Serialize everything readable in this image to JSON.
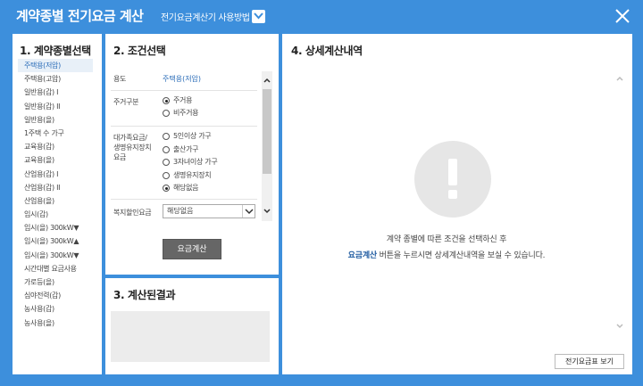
{
  "window": {
    "title": "계약종별 전기요금 계산",
    "help_link": "전기요금계산기 사용방법"
  },
  "panel1": {
    "title": "1. 계약종별선택",
    "items": [
      "주택용(저압)",
      "주택용(고압)",
      "일반용(갑) I",
      "일반용(갑) II",
      "일반용(을)",
      "1주택 수 가구",
      "교육용(갑)",
      "교육용(을)",
      "산업용(갑) I",
      "산업용(갑) II",
      "산업용(을)",
      "임시(갑)",
      "임시(을) 300kW▼",
      "임시(을) 300kW▲",
      "임시(을) 300kW▼",
      "시간대별 요금사용",
      "가로등(을)",
      "심야전력(갑)",
      "농사용(갑)",
      "농사용(을)"
    ],
    "selected_index": 0
  },
  "panel2": {
    "title": "2. 조건선택",
    "usage_label": "용도",
    "usage_value": "주택용(저압)",
    "residence_label": "주거구분",
    "residence_options": [
      "주거용",
      "비주거용"
    ],
    "residence_selected": 0,
    "discount_label": "대가족요금/\n생명유지장치\n요금",
    "discount_options": [
      "5인이상 가구",
      "출산가구",
      "3자녀이상 가구",
      "생명유지장치",
      "해당없음"
    ],
    "discount_selected": 4,
    "welfare_label": "복지할인요금",
    "welfare_value": "해당없음",
    "calc_button": "요금계산"
  },
  "panel3": {
    "title": "3. 계산된결과"
  },
  "panel4": {
    "title": "4. 상세계산내역",
    "message_line1": "계약 종별에 따른 조건을 선택하신 후",
    "message_link": "요금계산",
    "message_line2": " 버튼을 누르시면 상세계산내역을 보실 수 있습니다.",
    "tariff_button": "전기요금표 보기"
  },
  "colors": {
    "accent": "#3d8fdc",
    "link": "#2a6cb8"
  }
}
